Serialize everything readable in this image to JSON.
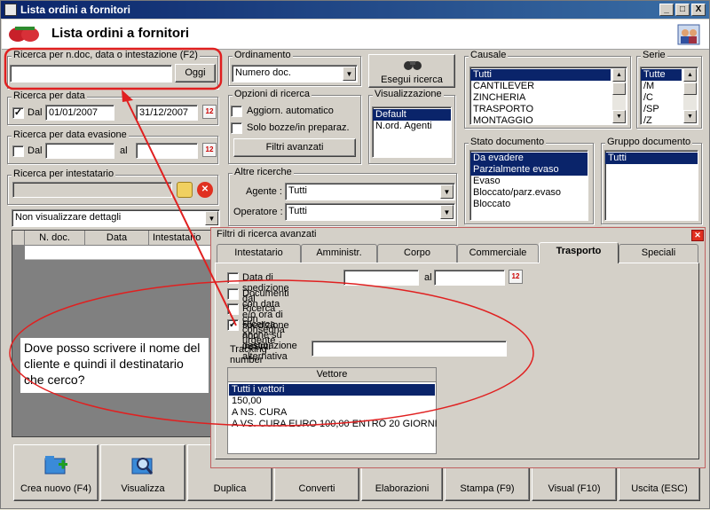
{
  "window": {
    "title": "Lista ordini a fornitori",
    "min": "_",
    "max": "□",
    "close": "X"
  },
  "header": {
    "title": "Lista ordini a fornitori"
  },
  "ricerca_doc": {
    "label": "Ricerca per n.doc, data o intestazione (F2)",
    "value": "",
    "btn": "Oggi"
  },
  "ricerca_data": {
    "label": "Ricerca per data",
    "dal_label": "Dal",
    "dal": "01/01/2007",
    "al": "31/12/2007",
    "checked": "✓"
  },
  "ricerca_evasione": {
    "label": "Ricerca per data evasione",
    "dal_label": "Dal",
    "al_label": "al",
    "dal": "",
    "al": ""
  },
  "ricerca_intestatario": {
    "label": "Ricerca per intestatario",
    "value": ""
  },
  "dettagli": {
    "value": "Non visualizzare dettagli"
  },
  "ordinamento": {
    "label": "Ordinamento",
    "value": "Numero doc."
  },
  "opzioni": {
    "label": "Opzioni di ricerca",
    "aggiorn": "Aggiorn. automatico",
    "solo_bozze": "Solo bozze/in preparaz.",
    "filtri_btn": "Filtri avanzati"
  },
  "esegui": {
    "label": "Esegui ricerca"
  },
  "visualizzazione": {
    "label": "Visualizzazione",
    "items": [
      "Default",
      "N.ord. Agenti"
    ]
  },
  "altre": {
    "label": "Altre ricerche",
    "agente_label": "Agente :",
    "agente": "Tutti",
    "operatore_label": "Operatore :",
    "operatore": "Tutti"
  },
  "causale": {
    "label": "Causale",
    "items": [
      "Tutti",
      "CANTILEVER",
      "ZINCHERIA",
      "TRASPORTO",
      "MONTAGGIO"
    ]
  },
  "serie": {
    "label": "Serie",
    "items": [
      "Tutte",
      "/M",
      "/C",
      "/SP",
      "/Z"
    ]
  },
  "stato": {
    "label": "Stato documento",
    "items": [
      "Da evadere",
      "Parzialmente evaso",
      "Evaso",
      "Bloccato/parz.evaso",
      "Bloccato"
    ]
  },
  "gruppo": {
    "label": "Gruppo documento",
    "items": [
      "Tutti"
    ]
  },
  "table": {
    "headers": [
      "N. doc.",
      "Data",
      "Intestatario"
    ]
  },
  "filtri": {
    "title": "Filtri di ricerca avanzati",
    "tabs": [
      "Intestatario",
      "Amministr.",
      "Corpo",
      "Commerciale",
      "Trasporto",
      "Speciali"
    ],
    "data_spedizione": "Data di spedizione dal",
    "al": "al",
    "doc_senza": "Documenti con data e/o ora di spedizione non inseriti",
    "consegna_urgente": "Ricerca con consegna urgente",
    "dest_alternativa": "Ricerca anche su destinazione alternativa",
    "dest_checked": "✓",
    "tracking_label": "Tracking number :",
    "tracking": "",
    "vettore_header": "Vettore",
    "vettori": [
      "Tutti i vettori",
      "150,00",
      "A NS. CURA",
      "A VS. CURA EURO 100,00 ENTRO 20 GIORNI"
    ]
  },
  "annotation": {
    "text": "Dove posso scrivere il nome del cliente e quindi il destinatario che cerco?"
  },
  "buttons": [
    "Crea nuovo (F4)",
    "Visualizza",
    "Duplica",
    "Converti",
    "Elaborazioni",
    "Stampa (F9)",
    "Visual (F10)",
    "Uscita (ESC)"
  ],
  "colors": {
    "highlight": "#0a246a",
    "annotation": "#e02020"
  }
}
